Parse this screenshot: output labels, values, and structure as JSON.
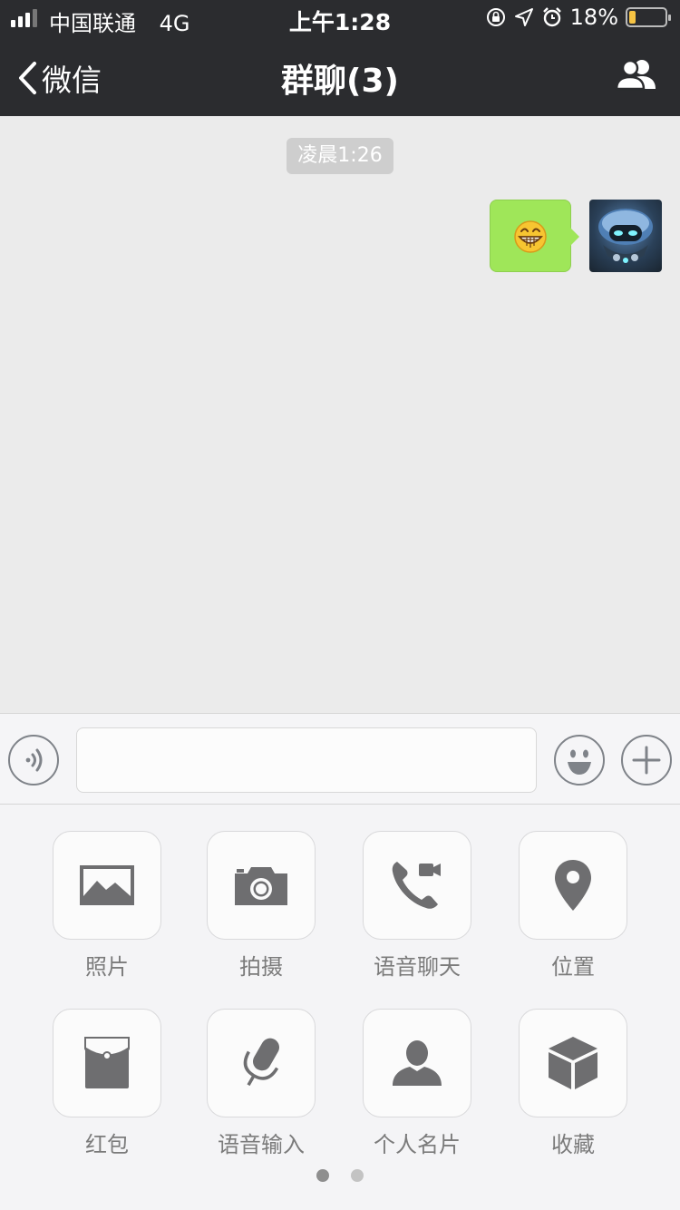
{
  "status_bar": {
    "carrier": "中国联通",
    "network": "4G",
    "time": "上午1:28",
    "battery_percent": "18%",
    "battery_level": 0.18
  },
  "nav": {
    "back_label": "微信",
    "title": "群聊(3)",
    "back_icon": "chevron-left-icon",
    "members_icon": "group-members-icon"
  },
  "chat": {
    "timestamp": "凌晨1:26",
    "messages": [
      {
        "sender": "me",
        "content_type": "emoji",
        "emoji": "😁"
      }
    ],
    "bubble_color": "#9fe659"
  },
  "input_bar": {
    "voice_icon": "voice-icon",
    "emoji_icon": "smiley-icon",
    "plus_icon": "plus-icon",
    "text_value": ""
  },
  "panel": {
    "items": [
      {
        "label": "照片",
        "icon": "photo-icon"
      },
      {
        "label": "拍摄",
        "icon": "camera-icon"
      },
      {
        "label": "语音聊天",
        "icon": "voice-call-icon"
      },
      {
        "label": "位置",
        "icon": "location-icon"
      },
      {
        "label": "红包",
        "icon": "red-packet-icon"
      },
      {
        "label": "语音输入",
        "icon": "microphone-icon"
      },
      {
        "label": "个人名片",
        "icon": "contact-card-icon"
      },
      {
        "label": "收藏",
        "icon": "favorites-icon"
      }
    ],
    "page_count": 2,
    "current_page": 1
  }
}
